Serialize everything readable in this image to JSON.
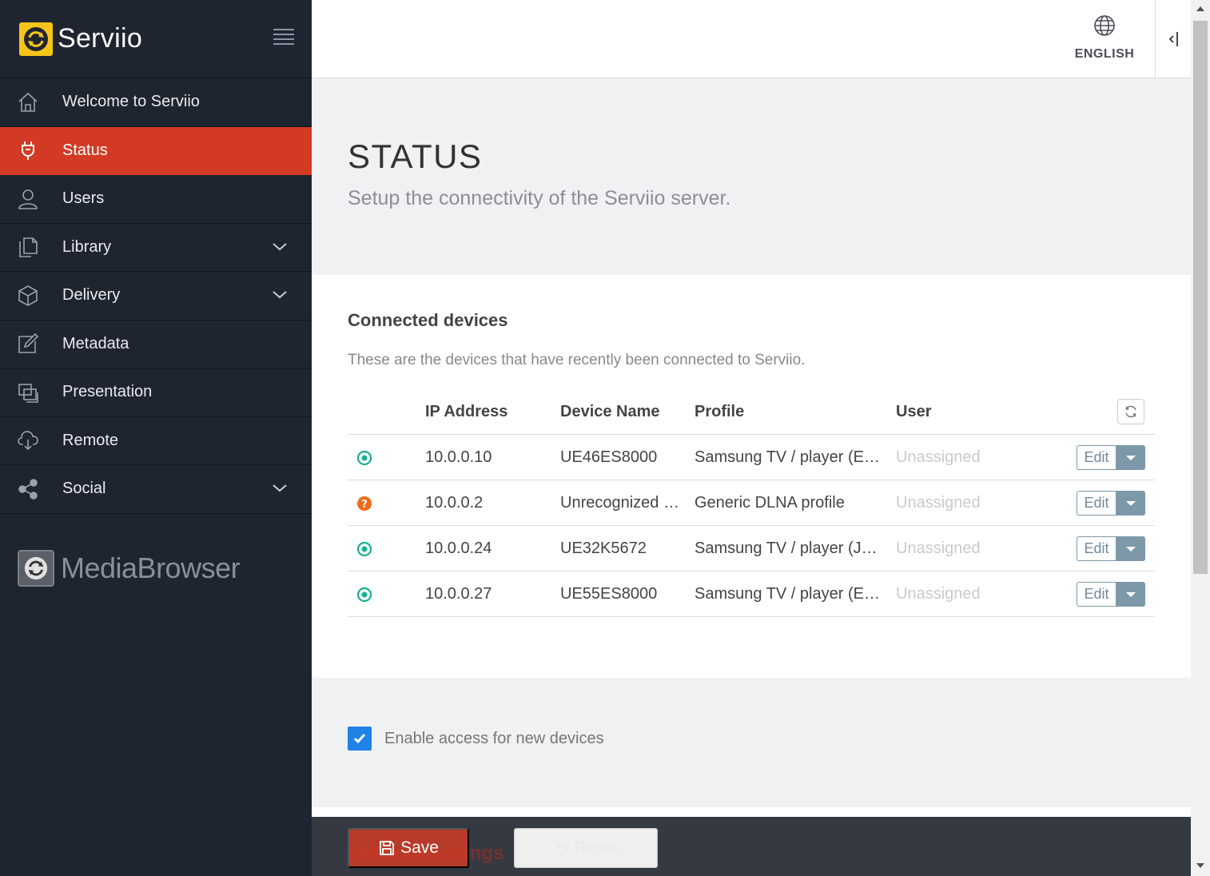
{
  "brand": {
    "name": "Serviio",
    "logo_icon": "serviio-logo-icon"
  },
  "sidebar": {
    "items": [
      {
        "label": "Welcome to Serviio",
        "icon": "home-icon",
        "active": false,
        "expandable": false
      },
      {
        "label": "Status",
        "icon": "plug-icon",
        "active": true,
        "expandable": false
      },
      {
        "label": "Users",
        "icon": "user-icon",
        "active": false,
        "expandable": false
      },
      {
        "label": "Library",
        "icon": "files-icon",
        "active": false,
        "expandable": true
      },
      {
        "label": "Delivery",
        "icon": "box-icon",
        "active": false,
        "expandable": true
      },
      {
        "label": "Metadata",
        "icon": "edit-icon",
        "active": false,
        "expandable": false
      },
      {
        "label": "Presentation",
        "icon": "windows-icon",
        "active": false,
        "expandable": false
      },
      {
        "label": "Remote",
        "icon": "cloud-icon",
        "active": false,
        "expandable": false
      },
      {
        "label": "Social",
        "icon": "share-icon",
        "active": false,
        "expandable": true
      }
    ],
    "mediabrowser": {
      "name": "MediaBrowser"
    }
  },
  "header": {
    "language": "ENGLISH"
  },
  "page": {
    "title": "STATUS",
    "subtitle": "Setup the connectivity of the Serviio server."
  },
  "devices": {
    "title": "Connected devices",
    "description": "These are the devices that have recently been connected to Serviio.",
    "columns": {
      "ip": "IP Address",
      "name": "Device Name",
      "profile": "Profile",
      "user": "User"
    },
    "rows": [
      {
        "status": "ok",
        "ip": "10.0.0.10",
        "name": "UE46ES8000",
        "profile": "Samsung TV / player (E…",
        "user": "Unassigned",
        "edit": "Edit"
      },
      {
        "status": "unknown",
        "ip": "10.0.0.2",
        "name": "Unrecognized …",
        "profile": "Generic DLNA profile",
        "user": "Unassigned",
        "edit": "Edit"
      },
      {
        "status": "ok",
        "ip": "10.0.0.24",
        "name": "UE32K5672",
        "profile": "Samsung TV / player (J-…",
        "user": "Unassigned",
        "edit": "Edit"
      },
      {
        "status": "ok",
        "ip": "10.0.0.27",
        "name": "UE55ES8000",
        "profile": "Samsung TV / player (E…",
        "user": "Unassigned",
        "edit": "Edit"
      }
    ],
    "status_colors": {
      "ok": "#1aaf91",
      "unknown": "#f06a1c"
    }
  },
  "settings": {
    "enable_new_devices": "Enable access for new devices",
    "enabled": true
  },
  "footer": {
    "save": "Save",
    "reset": "Reset",
    "behind_text": "Network settings"
  },
  "colors": {
    "accent": "#d23a23",
    "sidebar_bg": "#1f2530",
    "brand_yellow": "#f5c518",
    "checkbox": "#1e82e6"
  }
}
